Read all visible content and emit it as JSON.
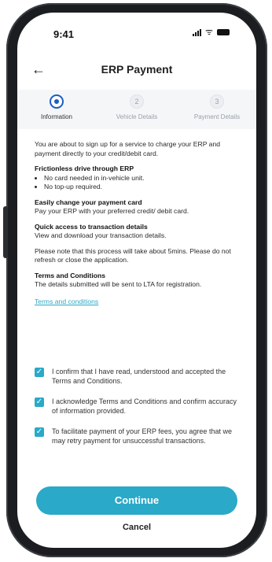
{
  "status_bar": {
    "time": "9:41",
    "signal_icon": "signal-icon",
    "wifi_icon": "wifi-icon",
    "battery_icon": "battery-icon"
  },
  "header": {
    "title": "ERP Payment",
    "back_icon": "arrow-left-icon"
  },
  "steps": [
    {
      "label": "Information",
      "number": "",
      "active": true
    },
    {
      "label": "Vehicle Details",
      "number": "2",
      "active": false
    },
    {
      "label": "Payment Details",
      "number": "3",
      "active": false
    }
  ],
  "content": {
    "intro": "You are about to sign up for a service to charge your ERP and payment directly to your credit/debit card.",
    "section1_title": "Frictionless drive through ERP",
    "section1_bullets": [
      "No card needed in in-vehicle unit.",
      "No top-up required."
    ],
    "section2_title": "Easily change your payment card",
    "section2_text": "Pay your ERP with your preferred credit/ debit card.",
    "section3_title": "Quick access to transaction details",
    "section3_text": "View and download your transaction details.",
    "note": "Please note that this process will take about 5mins. Please do not refresh or close the application.",
    "section4_title": "Terms and Conditions",
    "section4_text": "The details submitted will be sent to LTA for registration.",
    "terms_link": "Terms and conditions"
  },
  "checkboxes": [
    {
      "text": "I confirm that I have read, understood and accepted the Terms and Conditions.",
      "checked": true
    },
    {
      "text": "I acknowledge Terms and Conditions and confirm accuracy of information provided.",
      "checked": true
    },
    {
      "text": "To facilitate payment of your ERP fees, you agree that we may retry payment for unsuccessful transactions.",
      "checked": true
    }
  ],
  "actions": {
    "continue_label": "Continue",
    "cancel_label": "Cancel"
  },
  "colors": {
    "accent": "#2aa9c8",
    "step_active": "#1d5ec2"
  }
}
